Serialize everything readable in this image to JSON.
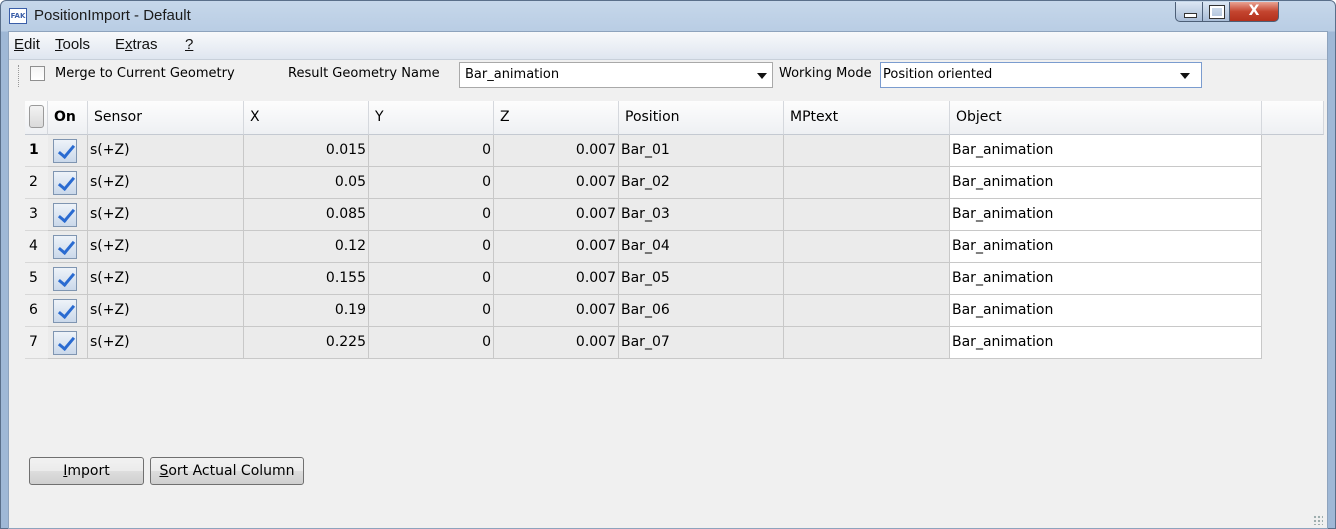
{
  "window": {
    "title": "PositionImport - Default",
    "app_icon": "FAK",
    "close_symbol": "X"
  },
  "menu": [
    {
      "label": "Edit",
      "mnemonic": "E",
      "rest": "dit"
    },
    {
      "label": "Tools",
      "mnemonic": "T",
      "rest": "ools"
    },
    {
      "label": "Extras",
      "pre": "E",
      "mnemonic": "x",
      "rest": "tras"
    },
    {
      "label": "?",
      "mnemonic": "?",
      "rest": ""
    }
  ],
  "toolbar": {
    "merge_label": "Merge to Current Geometry",
    "merge_checked": false,
    "result_name_label": "Result Geometry Name",
    "result_name_value": "Bar_animation",
    "working_mode_label": "Working Mode",
    "working_mode_value": "Position oriented"
  },
  "table": {
    "columns": [
      "On",
      "Sensor",
      "X",
      "Y",
      "Z",
      "Position",
      "MPtext",
      "Object"
    ],
    "rows": [
      {
        "n": "1",
        "on": true,
        "sensor": "s(+Z)",
        "x": "0.015",
        "y": "0",
        "z": "0.007",
        "position": "Bar_01",
        "mptext": "",
        "object": "Bar_animation"
      },
      {
        "n": "2",
        "on": true,
        "sensor": "s(+Z)",
        "x": "0.05",
        "y": "0",
        "z": "0.007",
        "position": "Bar_02",
        "mptext": "",
        "object": "Bar_animation"
      },
      {
        "n": "3",
        "on": true,
        "sensor": "s(+Z)",
        "x": "0.085",
        "y": "0",
        "z": "0.007",
        "position": "Bar_03",
        "mptext": "",
        "object": "Bar_animation"
      },
      {
        "n": "4",
        "on": true,
        "sensor": "s(+Z)",
        "x": "0.12",
        "y": "0",
        "z": "0.007",
        "position": "Bar_04",
        "mptext": "",
        "object": "Bar_animation"
      },
      {
        "n": "5",
        "on": true,
        "sensor": "s(+Z)",
        "x": "0.155",
        "y": "0",
        "z": "0.007",
        "position": "Bar_05",
        "mptext": "",
        "object": "Bar_animation"
      },
      {
        "n": "6",
        "on": true,
        "sensor": "s(+Z)",
        "x": "0.19",
        "y": "0",
        "z": "0.007",
        "position": "Bar_06",
        "mptext": "",
        "object": "Bar_animation"
      },
      {
        "n": "7",
        "on": true,
        "sensor": "s(+Z)",
        "x": "0.225",
        "y": "0",
        "z": "0.007",
        "position": "Bar_07",
        "mptext": "",
        "object": "Bar_animation"
      }
    ]
  },
  "buttons": {
    "import": {
      "mnemonic": "I",
      "rest": "mport"
    },
    "sort": {
      "mnemonic": "S",
      "rest": "ort Actual Column"
    }
  }
}
